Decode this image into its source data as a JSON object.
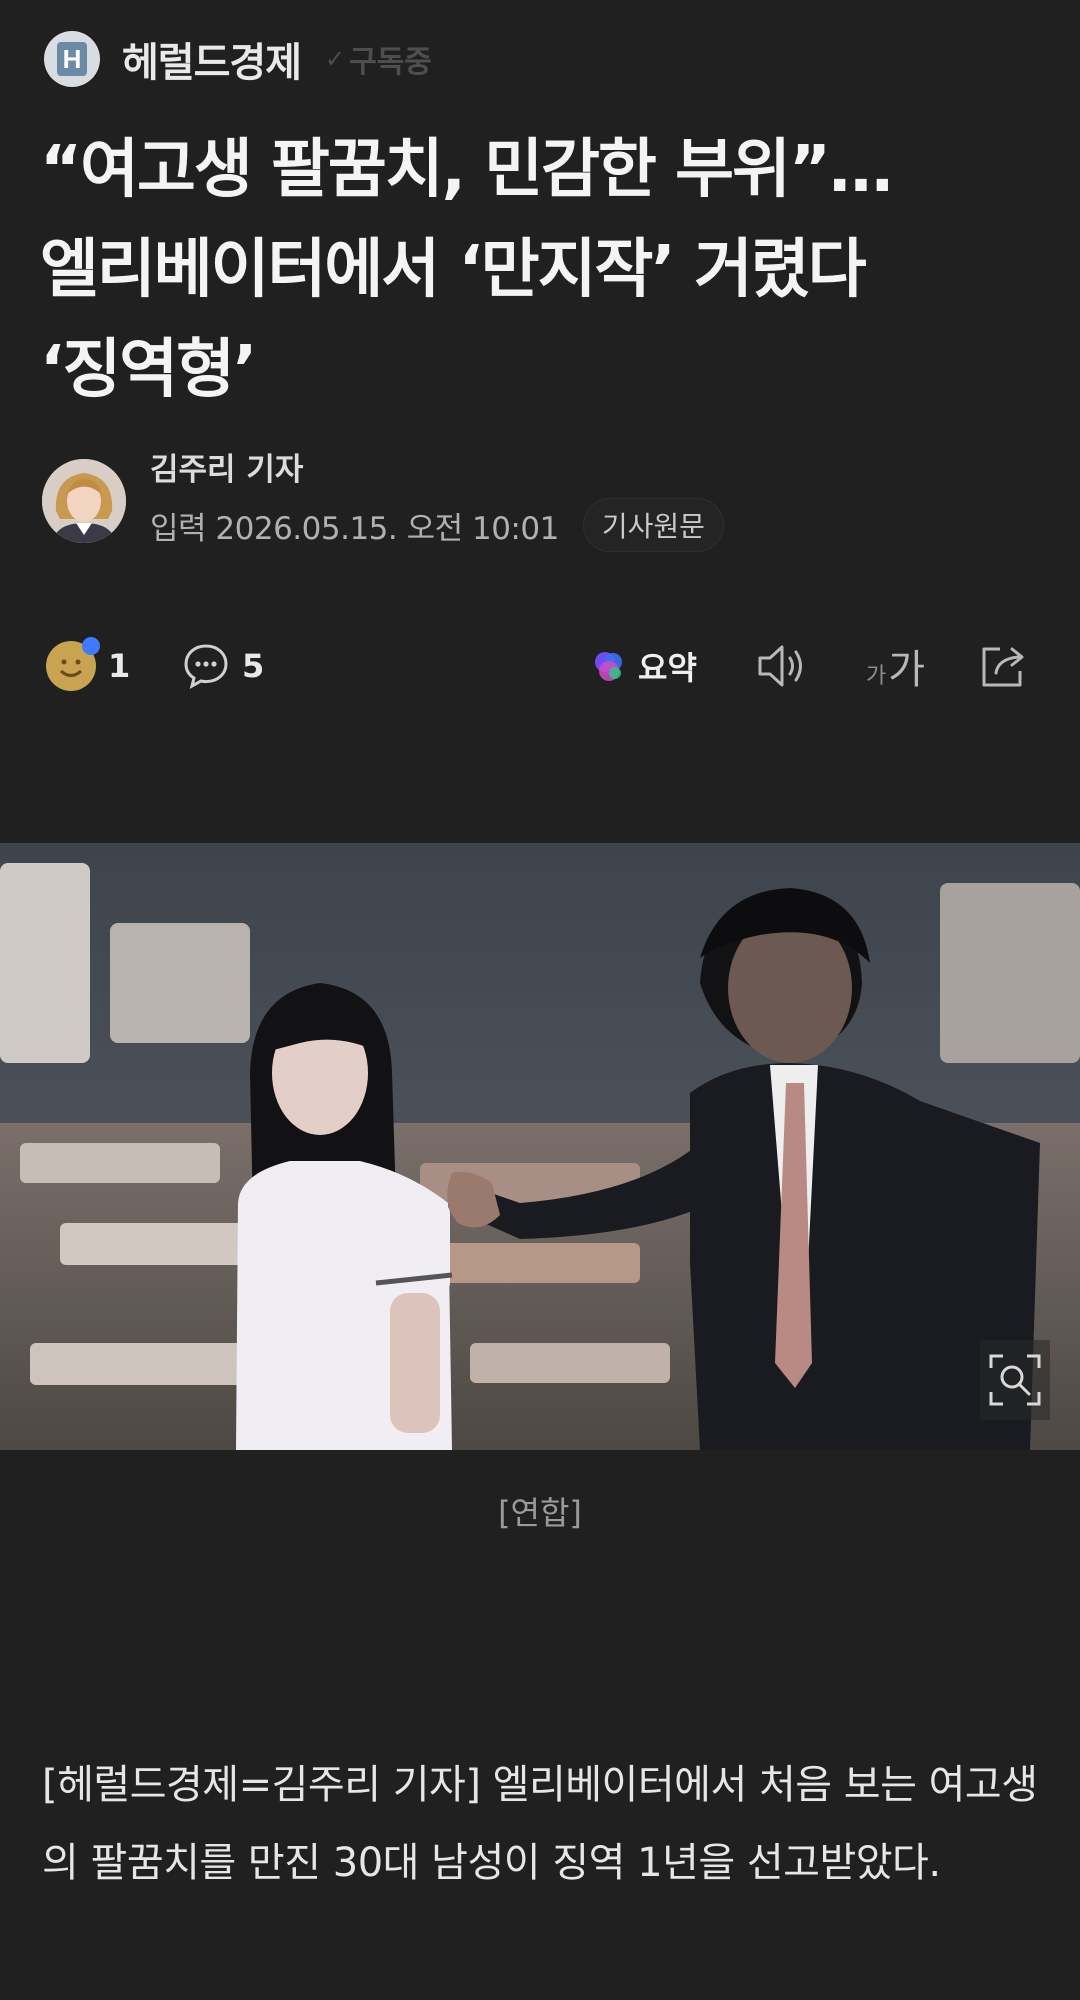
{
  "publisher": {
    "logo_letter": "H",
    "name": "헤럴드경제",
    "subscription_status": "구독중"
  },
  "article": {
    "headline_lines": [
      "“여고생 팔꿈치, 민감한 부위”…",
      "엘리베이터에서 ‘만지작’ 거렸다",
      "‘징역형’"
    ],
    "author": "김주리 기자",
    "published": "입력 2026.05.15. 오전 10:01",
    "original_link_label": "기사원문",
    "image_caption": "[연합]",
    "body": "[헤럴드경제=김주리 기자] 엘리베이터에서 처음 보는 여고생의 팔꿈치를 만진 30대 남성이 징역 1년을 선고받았다."
  },
  "actions": {
    "reaction_count": "1",
    "comment_count": "5",
    "summary_label": "요약",
    "font_small": "가",
    "font_large": "가"
  },
  "icons": {
    "reaction": "smile-emoji-icon",
    "comment": "comment-bubble-icon",
    "summary": "ai-summary-icon",
    "tts": "speaker-icon",
    "font": "font-size-icon",
    "share": "share-icon",
    "zoom": "zoom-icon"
  },
  "colors": {
    "background": "#202021",
    "text_primary": "#f4f4f4",
    "text_secondary": "#b1b1b3",
    "subscription": "#4e4e50"
  }
}
